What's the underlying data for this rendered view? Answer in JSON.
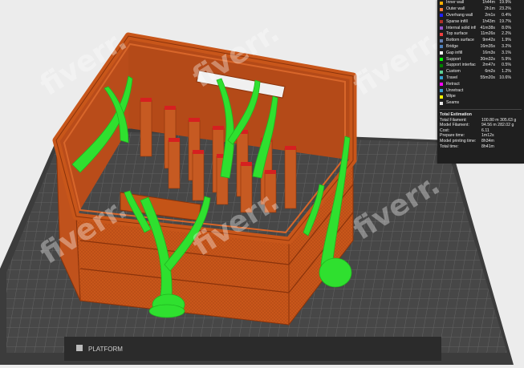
{
  "legend": {
    "features": [
      {
        "name": "Inner wall",
        "time": "1h44m",
        "pct": "19.9%",
        "color": "#ffb000"
      },
      {
        "name": "Outer wall",
        "time": "2h1m",
        "pct": "23.2%",
        "color": "#ff7d38"
      },
      {
        "name": "Overhang wall",
        "time": "2m1s",
        "pct": "0.4%",
        "color": "#1f20ff"
      },
      {
        "name": "Sparse infill",
        "time": "1h43m",
        "pct": "19.7%",
        "color": "#b03029"
      },
      {
        "name": "Internal solid infill",
        "time": "41m38s",
        "pct": "8.0%",
        "color": "#9654cc"
      },
      {
        "name": "Top surface",
        "time": "11m26s",
        "pct": "2.2%",
        "color": "#f04040"
      },
      {
        "name": "Bottom surface",
        "time": "9m42s",
        "pct": "1.9%",
        "color": "#667fb0"
      },
      {
        "name": "Bridge",
        "time": "16m35s",
        "pct": "3.2%",
        "color": "#4d80ba"
      },
      {
        "name": "Gap infill",
        "time": "16m3s",
        "pct": "3.1%",
        "color": "#ffffff"
      },
      {
        "name": "Support",
        "time": "30m32s",
        "pct": "5.9%",
        "color": "#00ff00"
      },
      {
        "name": "Support interface",
        "time": "2m47s",
        "pct": "0.5%",
        "color": "#008000"
      },
      {
        "name": "Custom",
        "time": "6m2s",
        "pct": "1.2%",
        "color": "#5ed194"
      },
      {
        "name": "Travel",
        "time": "55m20s",
        "pct": "10.6%",
        "color": "#38a0d0"
      },
      {
        "name": "Retract",
        "time": "",
        "pct": "",
        "color": "#ff00ff"
      },
      {
        "name": "Unretract",
        "time": "",
        "pct": "",
        "color": "#38a0d0"
      },
      {
        "name": "Wipe",
        "time": "",
        "pct": "",
        "color": "#ffff00"
      },
      {
        "name": "Seams",
        "time": "",
        "pct": "",
        "color": "#e6e6e6"
      }
    ],
    "estimation_title": "Total Estimation",
    "estimation": [
      {
        "k": "Total Filament:",
        "v": "100.80 m    305.63 g"
      },
      {
        "k": "Model Filament:",
        "v": "94.56 m    282.02 g"
      },
      {
        "k": "Cost:",
        "v": "6.11"
      },
      {
        "k": "Prepare time:",
        "v": "1m12s"
      },
      {
        "k": "Model printing time:",
        "v": "8h34m"
      },
      {
        "k": "Total time:",
        "v": "8h41m"
      }
    ]
  },
  "bed_label": "PLATFORM",
  "watermark": "fiverr.",
  "colors": {
    "crate": "#c8561a",
    "crate_dark": "#9f3b0e",
    "crate_light": "#d9692c",
    "support": "#2fe02f",
    "support_dark": "#1fb51f",
    "bed": "#4a4a4a",
    "bed_grid": "#6e6e6e"
  }
}
